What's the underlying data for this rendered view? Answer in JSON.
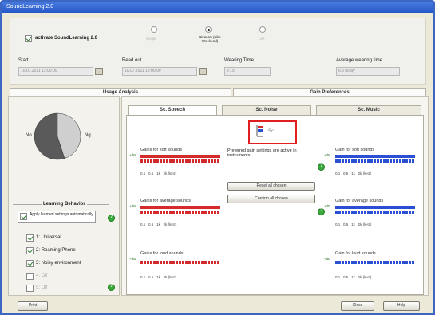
{
  "window": {
    "title": "SoundLearning 2.0"
  },
  "top": {
    "activate_label": "activate SoundLearning 2.0",
    "modes": [
      {
        "label": "Single",
        "selected": false
      },
      {
        "label": "Binaural (Like Weekend)",
        "selected": true
      },
      {
        "label": "Left",
        "selected": false
      }
    ],
    "fields": [
      {
        "label": "Start",
        "value": "10.07.2011 12:00:00"
      },
      {
        "label": "Read out",
        "value": "10.07.2011 12:00:00"
      },
      {
        "label": "Wearing Time",
        "value": "2:15"
      },
      {
        "label": "Average wearing time",
        "value": "6.5 h/day"
      }
    ]
  },
  "panels": {
    "left_tab": "Usage Analysis",
    "right_tab": "Gain Preferences"
  },
  "pie": {
    "label_left": "No",
    "label_right": "Ng",
    "shares": [
      0.58,
      0.42
    ],
    "colors": [
      "#5a5a5a",
      "#c8c8c8"
    ]
  },
  "learning": {
    "header": "Learning Behavior",
    "auto_label": "Apply learned settings automatically",
    "programs": [
      {
        "label": "1: Universal",
        "checked": true
      },
      {
        "label": "2: Roaming Phone",
        "checked": true
      },
      {
        "label": "3: Noisy environment",
        "checked": true
      },
      {
        "label": "4: Off",
        "checked": false
      },
      {
        "label": "5: Off",
        "checked": false
      }
    ]
  },
  "subtabs": [
    "Sc. Speech",
    "Sc. Noise",
    "Sc. Music"
  ],
  "legend_text": "Sc",
  "charts": {
    "left": [
      {
        "title": "Gains for soft sounds",
        "color": "#d42a2a"
      },
      {
        "title": "Gains for average sounds",
        "color": "#d42a2a"
      },
      {
        "title": "Gains for loud sounds",
        "color": "#d42a2a"
      }
    ],
    "right": [
      {
        "title": "Gain for soft sounds",
        "color": "#2a4fd4"
      },
      {
        "title": "Gain for average sounds",
        "color": "#2a4fd4"
      },
      {
        "title": "Gain for loud sounds",
        "color": "#2a4fd4"
      }
    ],
    "y_labels": [
      "+dB",
      "+dB",
      "+dB"
    ],
    "x_labels": [
      "0.1",
      "0.5",
      "1k",
      "2k (kHz)"
    ]
  },
  "middle": {
    "info": "Preferred gain settings are active in instruments",
    "reset_btn": "Reset all chosen",
    "confirm_btn": "Confirm all chosen"
  },
  "footer": {
    "print": "Print",
    "close": "Close",
    "help": "Help"
  }
}
